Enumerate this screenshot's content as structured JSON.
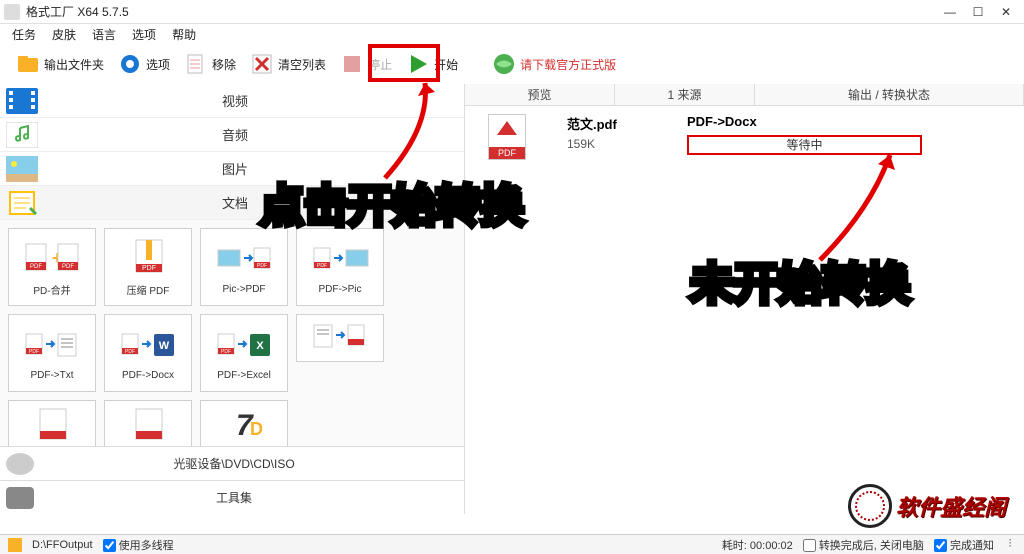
{
  "window": {
    "title": "格式工厂 X64 5.7.5"
  },
  "menu": {
    "tasks": "任务",
    "skin": "皮肤",
    "language": "语言",
    "options": "选项",
    "help": "帮助"
  },
  "toolbar": {
    "output_folder": "输出文件夹",
    "options": "选项",
    "remove": "移除",
    "clear_list": "清空列表",
    "stop": "停止",
    "start": "开始",
    "download": "请下载官方正式版"
  },
  "categories": {
    "video": "视频",
    "audio": "音频",
    "image": "图片",
    "document": "文档",
    "toolbox": "工具集"
  },
  "tools": {
    "pdf_merge": "PD-合并",
    "pdf_compress": "压缩 PDF",
    "pic_to_pdf": "Pic->PDF",
    "pdf_to_pic": "PDF->Pic",
    "pdf_to_txt": "PDF->Txt",
    "pdf_to_docx": "PDF->Docx",
    "pdf_to_excel": "PDF->Excel"
  },
  "drives": {
    "optical": "光驱设备\\DVD\\CD\\ISO"
  },
  "right": {
    "col_preview": "预览",
    "col_source": "1 来源",
    "col_status": "输出 / 转换状态",
    "file_name": "范文.pdf",
    "file_size": "159K",
    "operation": "PDF->Docx",
    "status": "等待中"
  },
  "status": {
    "output_path": "D:\\FFOutput",
    "multithread": "使用多线程",
    "elapsed": "耗时: 00:00:02",
    "shutdown": "转换完成后, 关闭电脑",
    "notify": "完成通知"
  },
  "overlay": {
    "click_start": "点击开始转换",
    "not_started": "未开始转换"
  },
  "watermark": "软件盛经阁"
}
